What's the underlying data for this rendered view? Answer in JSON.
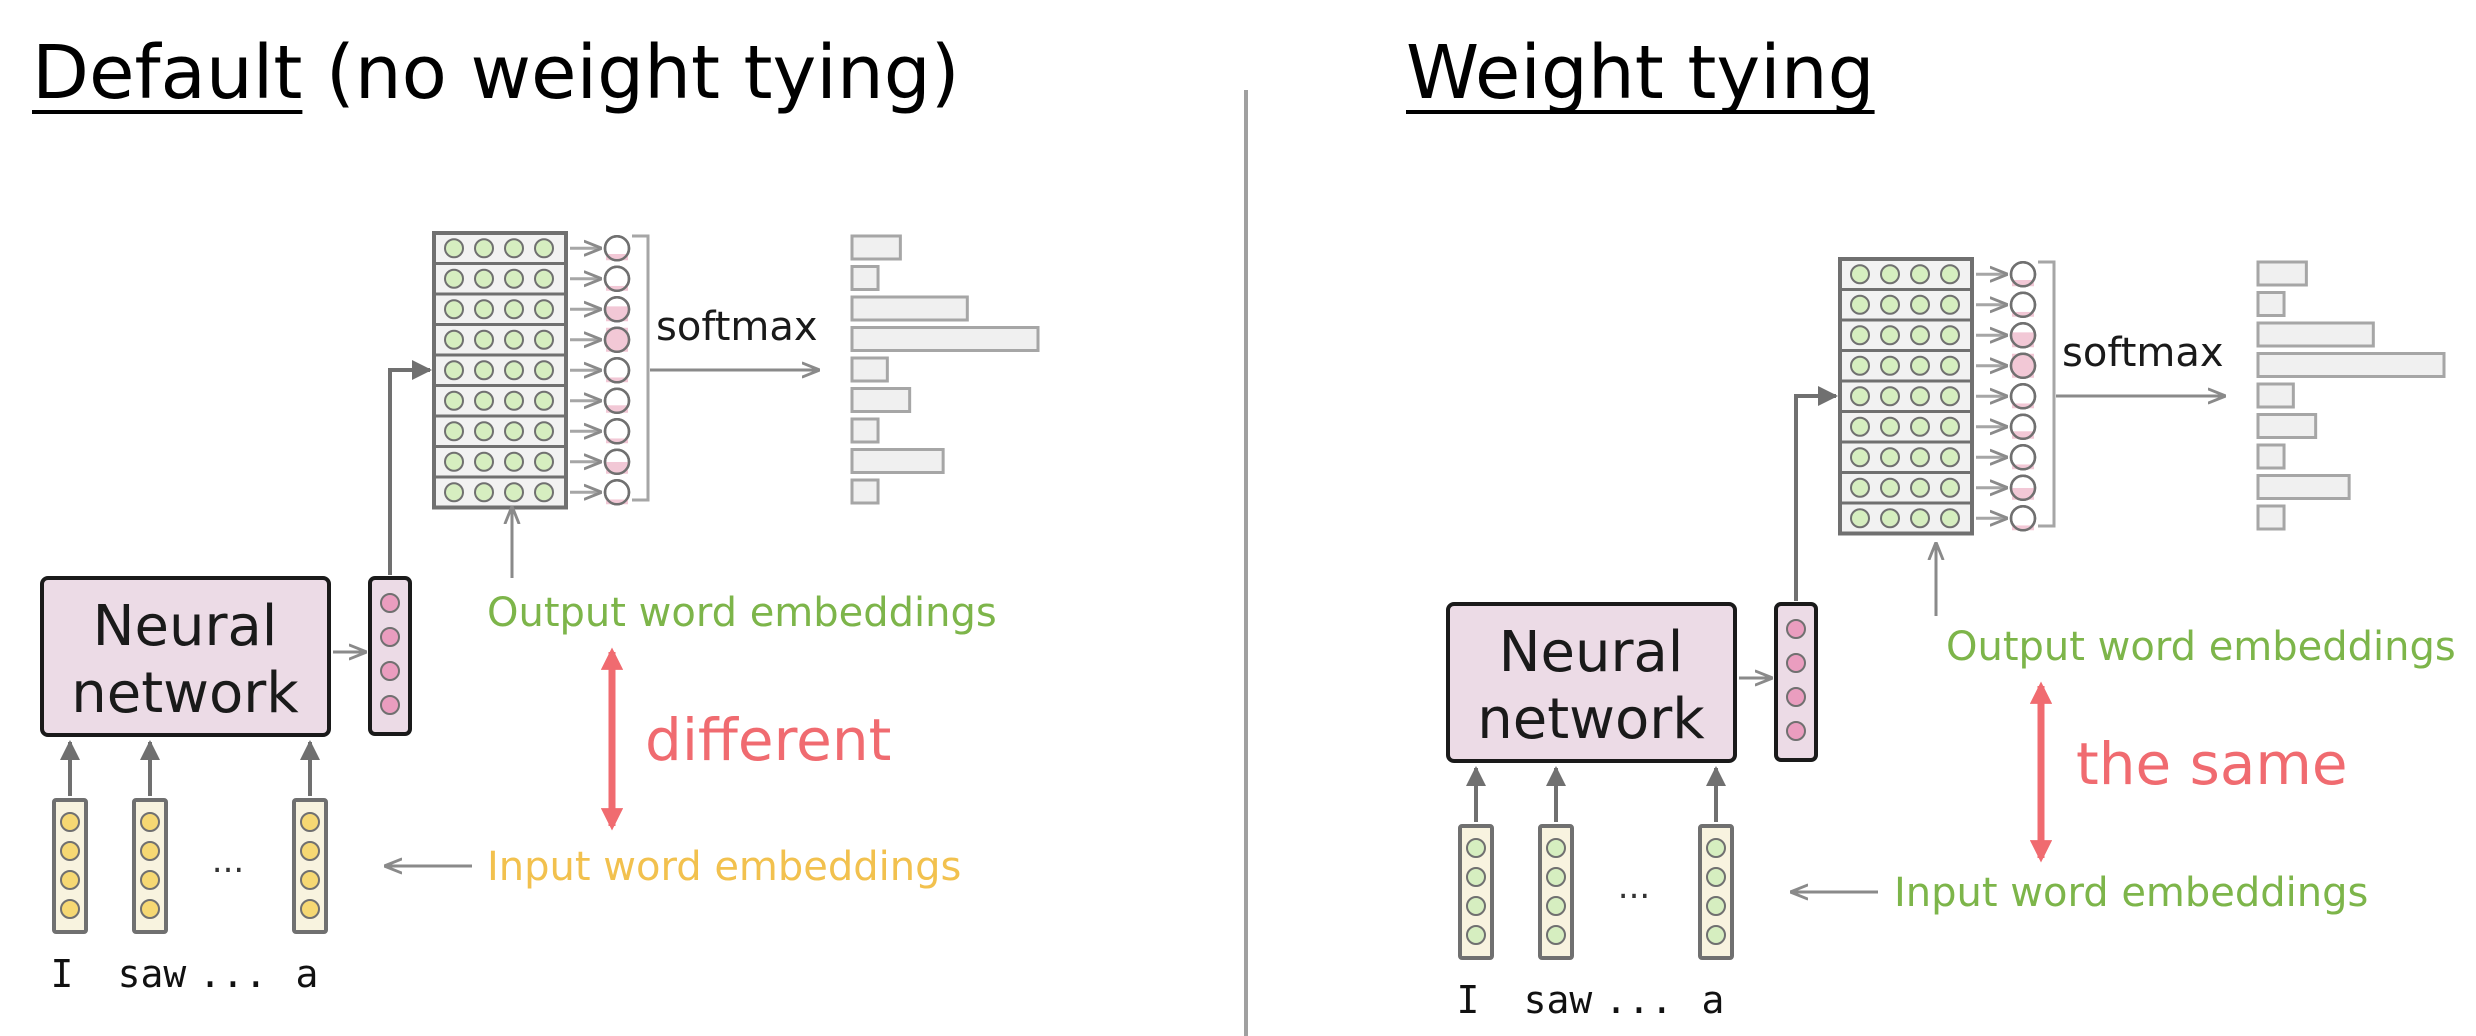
{
  "colors": {
    "nn_fill": "#ecdbe6",
    "embed_fill": "#d6eec0",
    "input_dot_default": "#f6d873",
    "hidden_dot": "#ea9dbf",
    "output_green": "#7db54a",
    "input_yellow": "#f2c14e",
    "accent_red": "#f06b70",
    "stroke_gray": "#707070",
    "bar_fill": "#f0f0f0",
    "bar_stroke": "#a6a6a6"
  },
  "panels": [
    {
      "id": "default",
      "title_underlined": "Default",
      "title_rest": " (no weight tying)",
      "nn_line1": "Neural",
      "nn_line2": "network",
      "softmax": "softmax",
      "output_label": "Output word embeddings",
      "input_label": "Input word embeddings",
      "relation": "different",
      "input_label_color": "input_yellow",
      "words": [
        "I",
        "saw",
        "...",
        "a"
      ],
      "ellipsis": "...",
      "bars": [
        0.26,
        0.14,
        0.62,
        1.0,
        0.19,
        0.31,
        0.14,
        0.49,
        0.14
      ]
    },
    {
      "id": "tied",
      "title_underlined": "Weight tying",
      "title_rest": "",
      "nn_line1": "Neural",
      "nn_line2": "network",
      "softmax": "softmax",
      "output_label": "Output word embeddings",
      "input_label": "Input word embeddings",
      "relation": "the same",
      "input_label_color": "output_green",
      "words": [
        "I",
        "saw",
        "...",
        "a"
      ],
      "ellipsis": "...",
      "bars": [
        0.26,
        0.14,
        0.62,
        1.0,
        0.19,
        0.31,
        0.14,
        0.49,
        0.14
      ]
    }
  ]
}
